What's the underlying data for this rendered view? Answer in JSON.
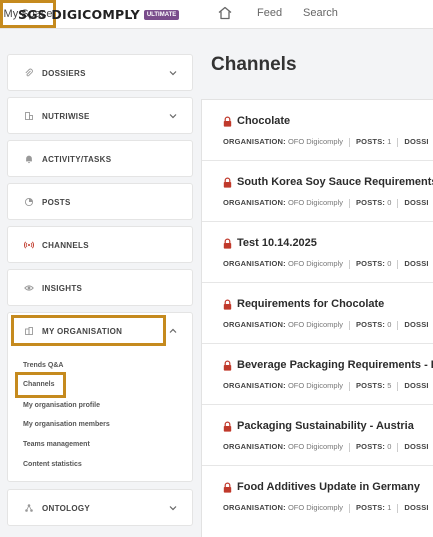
{
  "header": {
    "logo_text": "SGS DIGICOMPLY",
    "logo_badge": "ULTIMATE",
    "nav": {
      "feed": "Feed",
      "search": "Search",
      "my_space": "My Space"
    }
  },
  "sidebar": {
    "items": [
      {
        "label": "DOSSIERS",
        "icon": "paperclip-icon"
      },
      {
        "label": "NUTRIWISE",
        "icon": "nutriwise-icon"
      },
      {
        "label": "ACTIVITY/TASKS",
        "icon": "bell-icon"
      },
      {
        "label": "POSTS",
        "icon": "posts-icon"
      },
      {
        "label": "CHANNELS",
        "icon": "broadcast-icon"
      },
      {
        "label": "INSIGHTS",
        "icon": "eye-icon"
      },
      {
        "label": "MY ORGANISATION",
        "icon": "organisation-icon"
      },
      {
        "label": "ONTOLOGY",
        "icon": "ontology-icon"
      }
    ],
    "org_subitems": [
      "Trends Q&A",
      "Channels",
      "My organisation profile",
      "My organisation members",
      "Teams management",
      "Content statistics"
    ]
  },
  "main": {
    "title": "Channels",
    "meta_labels": {
      "organisation": "ORGANISATION:",
      "posts": "POSTS:",
      "dossiers": "DOSSI"
    },
    "channels": [
      {
        "title": "Chocolate",
        "organisation": "OFO Digicomply",
        "posts": "1"
      },
      {
        "title": "South Korea Soy Sauce Requirements",
        "organisation": "OFO Digicomply",
        "posts": "0"
      },
      {
        "title": "Test 10.14.2025",
        "organisation": "OFO Digicomply",
        "posts": "0"
      },
      {
        "title": "Requirements for Chocolate",
        "organisation": "OFO Digicomply",
        "posts": "0"
      },
      {
        "title": "Beverage Packaging Requirements - EU",
        "organisation": "OFO Digicomply",
        "posts": "5"
      },
      {
        "title": "Packaging Sustainability - Austria",
        "organisation": "OFO Digicomply",
        "posts": "0"
      },
      {
        "title": "Food Additives Update in Germany",
        "organisation": "OFO Digicomply",
        "posts": "1"
      }
    ]
  },
  "colors": {
    "highlight": "#c58a1e",
    "lock": "#c0392b",
    "badge": "#7a4d8c"
  }
}
